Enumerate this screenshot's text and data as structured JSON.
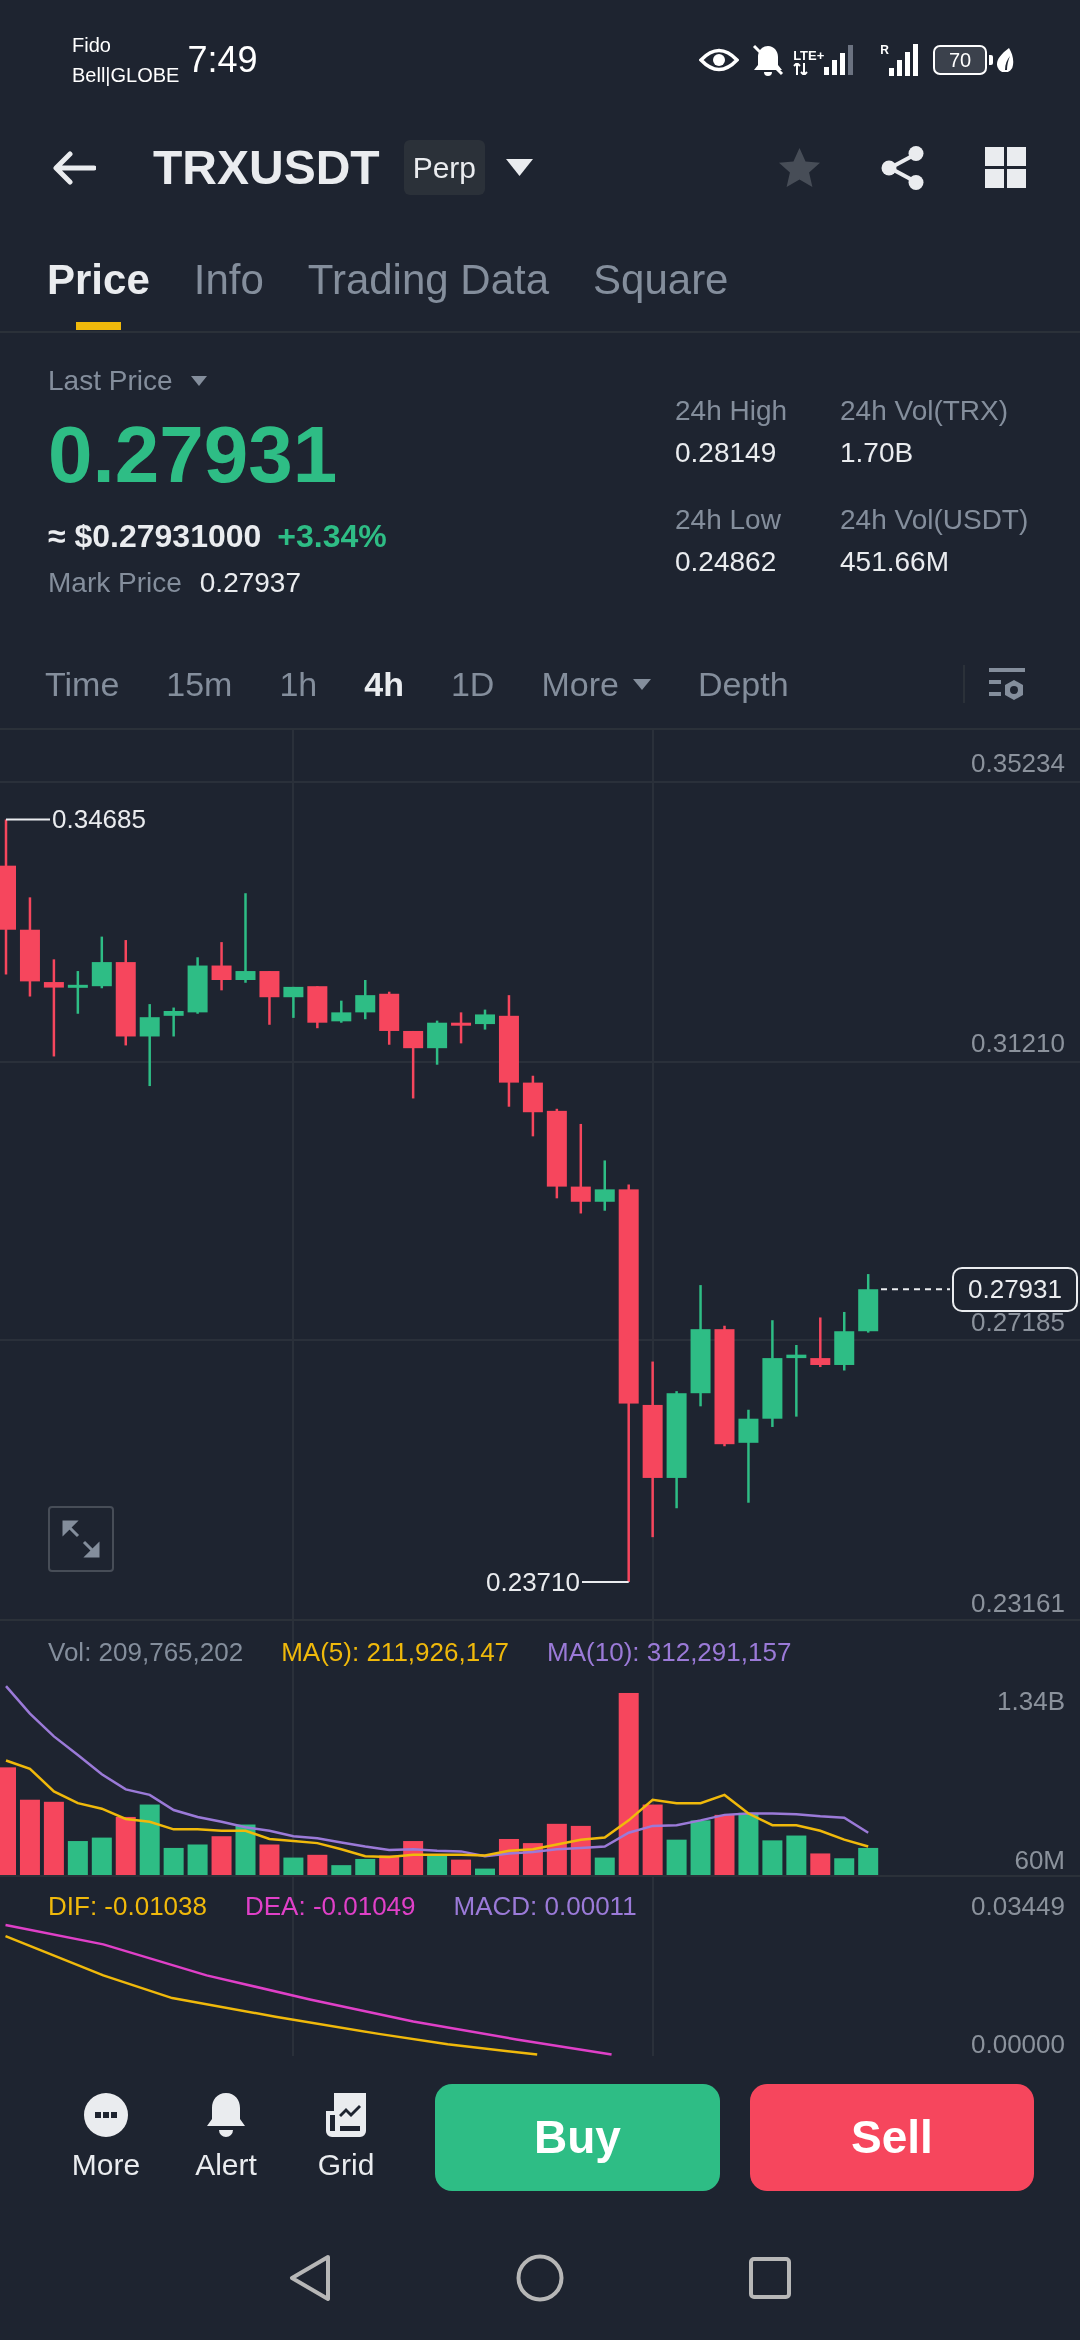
{
  "status_bar": {
    "carrier_1": "Fido",
    "carrier_2": "Bell|GLOBE",
    "time": "7:49",
    "network": "LTE+",
    "roaming": "R",
    "battery": "70"
  },
  "header": {
    "symbol": "TRXUSDT",
    "contract": "Perp",
    "favorite": false
  },
  "tabs": [
    {
      "label": "Price",
      "selected": true
    },
    {
      "label": "Info",
      "selected": false
    },
    {
      "label": "Trading Data",
      "selected": false
    },
    {
      "label": "Square",
      "selected": false
    }
  ],
  "ticker": {
    "price_label": "Last Price",
    "last_price": "0.27931",
    "usd_value": "≈ $0.27931000",
    "change": "+3.34%",
    "mark_price_label": "Mark Price",
    "mark_price": "0.27937",
    "stats": [
      {
        "label": "24h High",
        "value": "0.28149"
      },
      {
        "label": "24h Vol(TRX)",
        "value": "1.70B"
      },
      {
        "label": "24h Low",
        "value": "0.24862"
      },
      {
        "label": "24h Vol(USDT)",
        "value": "451.66M"
      }
    ]
  },
  "intervals": [
    {
      "label": "Time",
      "kind": "option",
      "selected": false
    },
    {
      "label": "15m",
      "kind": "option",
      "selected": false
    },
    {
      "label": "1h",
      "kind": "option",
      "selected": false
    },
    {
      "label": "4h",
      "kind": "option",
      "selected": true
    },
    {
      "label": "1D",
      "kind": "option",
      "selected": false
    },
    {
      "label": "More",
      "kind": "dropdown",
      "selected": false
    },
    {
      "label": "Depth",
      "kind": "option",
      "selected": false
    }
  ],
  "price_chart": {
    "axis_labels": [
      "0.35234",
      "0.31210",
      "0.27185",
      "0.23161"
    ],
    "high_marker": "0.34685",
    "low_marker": "0.23710",
    "current_price": "0.27931"
  },
  "volume_panel": {
    "legend": [
      {
        "text": "Vol: 209,765,202",
        "color": "#848e9c"
      },
      {
        "text": "MA(5): 211,926,147",
        "color": "#f0b90b"
      },
      {
        "text": "MA(10): 312,291,157",
        "color": "#9b7ad8"
      }
    ],
    "axis_labels": [
      "1.34B",
      "60M"
    ]
  },
  "macd_panel": {
    "legend": [
      {
        "text": "DIF: -0.01038",
        "color": "#f0b90b"
      },
      {
        "text": "DEA: -0.01049",
        "color": "#e040c8"
      },
      {
        "text": "MACD: 0.00011",
        "color": "#9b7ad8"
      }
    ],
    "axis_labels": [
      "0.03449",
      "0.00000"
    ]
  },
  "actions": [
    {
      "label": "More",
      "kind": "more"
    },
    {
      "label": "Alert",
      "kind": "alert"
    },
    {
      "label": "Grid",
      "kind": "grid"
    }
  ],
  "trade_buttons": [
    {
      "label": "Buy",
      "kind": "buy"
    },
    {
      "label": "Sell",
      "kind": "sell"
    }
  ]
}
